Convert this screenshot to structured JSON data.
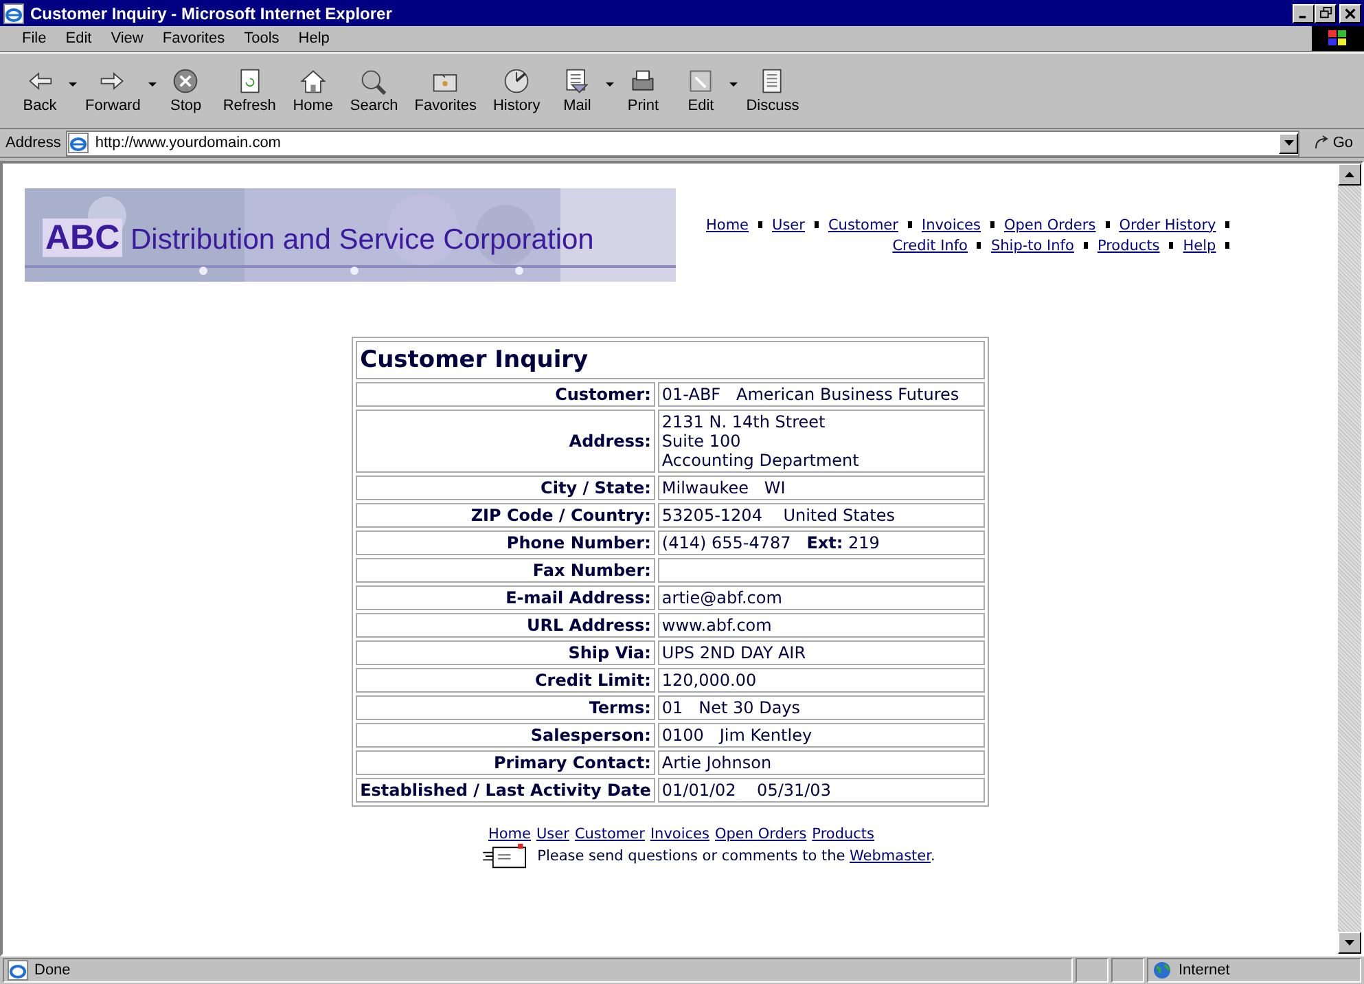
{
  "window": {
    "title": "Customer Inquiry - Microsoft Internet Explorer"
  },
  "menu": [
    "File",
    "Edit",
    "View",
    "Favorites",
    "Tools",
    "Help"
  ],
  "toolbar": [
    {
      "label": "Back",
      "kind": "back",
      "has_menu": true
    },
    {
      "label": "Forward",
      "kind": "forward",
      "has_menu": true
    },
    {
      "label": "Stop",
      "kind": "stop",
      "has_menu": false
    },
    {
      "label": "Refresh",
      "kind": "refresh",
      "has_menu": false
    },
    {
      "label": "Home",
      "kind": "home",
      "has_menu": false
    },
    {
      "label": "Search",
      "kind": "search",
      "has_menu": false
    },
    {
      "label": "Favorites",
      "kind": "favorites",
      "has_menu": false
    },
    {
      "label": "History",
      "kind": "history",
      "has_menu": false
    },
    {
      "label": "Mail",
      "kind": "mail",
      "has_menu": true
    },
    {
      "label": "Print",
      "kind": "print",
      "has_menu": false
    },
    {
      "label": "Edit",
      "kind": "edit",
      "has_menu": true
    },
    {
      "label": "Discuss",
      "kind": "discuss",
      "has_menu": false
    }
  ],
  "address_bar": {
    "label": "Address",
    "value": "http://www.yourdomain.com",
    "go": "Go"
  },
  "page": {
    "logo": {
      "kind": "picture",
      "strong": "ABC",
      "rest": "Distribution and Service Corporation"
    },
    "nav_rows": [
      [
        "Home",
        "User",
        "Customer",
        "Invoices",
        "Open Orders",
        "Order History"
      ],
      [
        "Credit Info",
        "Ship-to Info",
        "Products",
        "Help"
      ]
    ],
    "inquiry": {
      "title": "Customer Inquiry",
      "rows": [
        {
          "label": "Customer:",
          "lines": [
            "01-ABF   American Business Futures"
          ]
        },
        {
          "label": "Address:",
          "lines": [
            "2131 N. 14th Street",
            "Suite 100",
            "Accounting Department"
          ]
        },
        {
          "label": "City / State:",
          "lines": [
            "Milwaukee   WI"
          ]
        },
        {
          "label": "ZIP Code / Country:",
          "lines": [
            "53205-1204    United States"
          ]
        },
        {
          "label": "Phone Number:",
          "lines": [
            "(414) 655-4787   **Ext:** 219"
          ]
        },
        {
          "label": "Fax Number:",
          "lines": []
        },
        {
          "label": "E-mail Address:",
          "lines": [
            "artie@abf.com"
          ]
        },
        {
          "label": "URL Address:",
          "lines": [
            "www.abf.com"
          ]
        },
        {
          "label": "Ship Via:",
          "lines": [
            "UPS 2ND DAY AIR"
          ]
        },
        {
          "label": "Credit Limit:",
          "lines": [
            "120,000.00"
          ]
        },
        {
          "label": "Terms:",
          "lines": [
            "01   Net 30 Days"
          ]
        },
        {
          "label": "Salesperson:",
          "lines": [
            "0100   Jim Kentley"
          ]
        },
        {
          "label": "Primary Contact:",
          "lines": [
            "Artie Johnson"
          ]
        },
        {
          "label": "Established / Last Activity Date",
          "lines": [
            "01/01/02    05/31/03"
          ]
        }
      ]
    },
    "footer_links": [
      "Home",
      "User",
      "Customer",
      "Invoices",
      "Open Orders",
      "Products"
    ],
    "footer_text": {
      "before": "Please send questions or comments to the ",
      "link": "Webmaster",
      "after": "."
    }
  },
  "status_bar": {
    "text": "Done",
    "zone": "Internet"
  }
}
